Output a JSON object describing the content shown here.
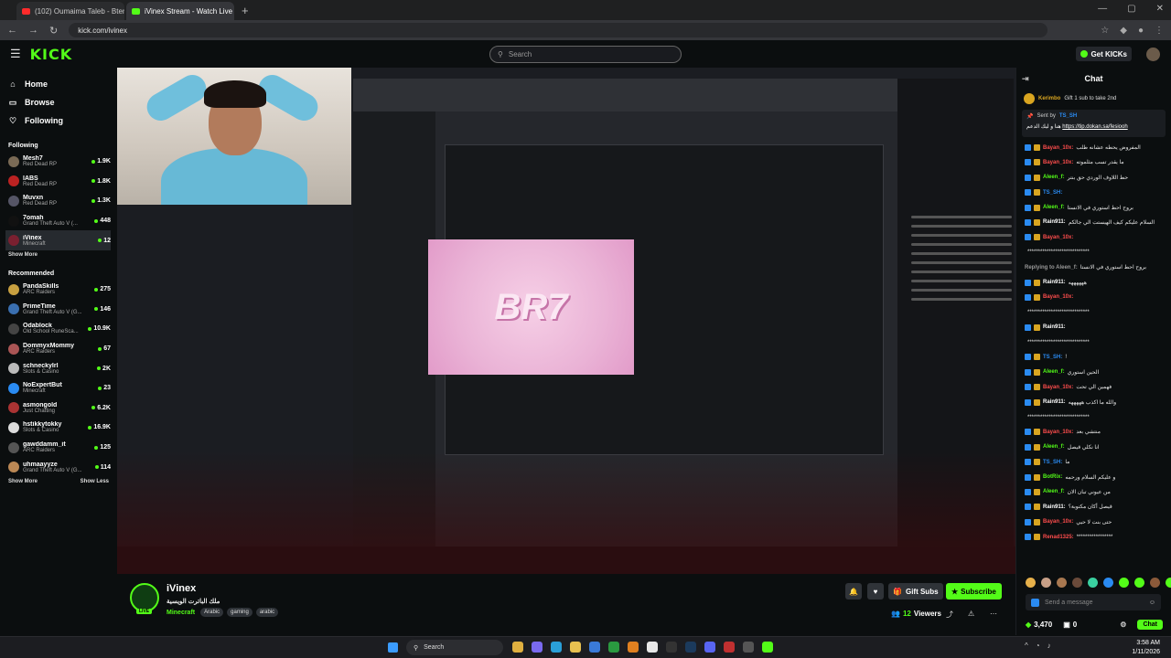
{
  "browser": {
    "tabs": [
      {
        "title": "(102) Oumaima Taleb - Bterjo",
        "color": "#ff2b2b",
        "active": false
      },
      {
        "title": "iVinex Stream - Watch Live on",
        "color": "#53fc18",
        "active": true
      }
    ],
    "url": "kick.com/ivinex"
  },
  "header": {
    "logo": "KICK",
    "search_placeholder": "Search",
    "get_kicks": "Get KICKs"
  },
  "sidebar": {
    "nav": [
      {
        "label": "Home",
        "icon": "home-icon",
        "glyph": "⌂"
      },
      {
        "label": "Browse",
        "icon": "browse-icon",
        "glyph": "▭"
      },
      {
        "label": "Following",
        "icon": "heart-icon",
        "glyph": "♡"
      }
    ],
    "following_title": "Following",
    "following": [
      {
        "name": "Mesh7",
        "category": "Red Dead RP",
        "viewers": "1.9K",
        "color": "#7a6a55"
      },
      {
        "name": "IABS",
        "category": "Red Dead RP",
        "viewers": "1.8K",
        "color": "#b22"
      },
      {
        "name": "Muvxn",
        "category": "Red Dead RP",
        "viewers": "1.3K",
        "color": "#556"
      },
      {
        "name": "7omah",
        "category": "Grand Theft Auto V (...",
        "viewers": "448",
        "color": "#111"
      },
      {
        "name": "iVinex",
        "category": "Minecraft",
        "viewers": "12",
        "color": "#7a2030"
      }
    ],
    "show_more": "Show More",
    "recommended_title": "Recommended",
    "recommended": [
      {
        "name": "PandaSkills",
        "category": "ARC Raiders",
        "viewers": "275",
        "color": "#c8a040"
      },
      {
        "name": "PrimeTime",
        "category": "Grand Theft Auto V (G...",
        "viewers": "146",
        "color": "#3a6fb0"
      },
      {
        "name": "Odablock",
        "category": "Old School RuneSca...",
        "viewers": "10.9K",
        "color": "#444"
      },
      {
        "name": "DommyxMommy",
        "category": "ARC Raiders",
        "viewers": "67",
        "color": "#a55"
      },
      {
        "name": "schneckyIrl",
        "category": "Slots & Casino",
        "viewers": "2K",
        "color": "#bbb"
      },
      {
        "name": "NoExpertBut",
        "category": "Minecraft",
        "viewers": "23",
        "color": "#2a8bf2"
      },
      {
        "name": "asmongold",
        "category": "Just Chatting",
        "viewers": "6.2K",
        "color": "#a33"
      },
      {
        "name": "hstikkytokky",
        "category": "Slots & Casino",
        "viewers": "16.9K",
        "color": "#ddd"
      },
      {
        "name": "gawddamm_it",
        "category": "ARC Raiders",
        "viewers": "125",
        "color": "#555"
      },
      {
        "name": "uhmaayyze",
        "category": "Grand Theft Auto V (G...",
        "viewers": "114",
        "color": "#b85"
      }
    ],
    "show_more_2": "Show More",
    "show_less": "Show Less"
  },
  "stream": {
    "streamer": "iVinex",
    "title": "ملك الباترت الويسية",
    "category": "Minecraft",
    "tags": [
      "Arabic",
      "gaming",
      "arabic"
    ],
    "live_label": "LIVE",
    "gift_subs": "Gift Subs",
    "subscribe": "Subscribe",
    "viewers": "12",
    "viewers_label": "Viewers",
    "video_text": "BR7"
  },
  "chat": {
    "title": "Chat",
    "gifter_name": "Kerimbo",
    "gifter_text": "Gift 1 sub to take 2nd",
    "pinned_sent_by": "Sent by",
    "pinned_user": "TS_SH",
    "pinned_text": "هنا و ليك الدعم",
    "pinned_link": "https://tip.dokan.sa/fesiooh",
    "messages": [
      {
        "user": "Bayan_10x:",
        "color": "#ff4d4d",
        "text": "المفروض يحطه عشانه طلب"
      },
      {
        "user": "Bayan_10x:",
        "color": "#ff4d4d",
        "text": "ما يقدر تسب مثلموته"
      },
      {
        "user": "Aleen_f:",
        "color": "#53fc18",
        "text": "حط اللاوف الوردي حق بنتر"
      },
      {
        "user": "TS_SH:",
        "color": "#2a8bf2",
        "text": ""
      },
      {
        "user": "Aleen_f:",
        "color": "#53fc18",
        "text": "بروح احط استوري في الانستا"
      },
      {
        "user": "Rain911:",
        "color": "#ffffff",
        "text": "السلام عليكم كيف الهيستت الي جالكم"
      },
      {
        "user": "Bayan_10x:",
        "color": "#ff4d4d",
        "text": ""
      },
      {
        "user": "",
        "color": "#ffffff",
        "text": "*****************************"
      },
      {
        "user": "Replying to Aleen_f:",
        "color": "#999999",
        "text": "بروح احط استوري في الانستا"
      },
      {
        "user": "Rain911:",
        "color": "#ffffff",
        "text": "ههههههه"
      },
      {
        "user": "Bayan_10x:",
        "color": "#ff4d4d",
        "text": ""
      },
      {
        "user": "",
        "color": "#ffffff",
        "text": "*****************************"
      },
      {
        "user": "Rain911:",
        "color": "#ffffff",
        "text": ""
      },
      {
        "user": "",
        "color": "#ffffff",
        "text": "*****************************"
      },
      {
        "user": "TS_SH:",
        "color": "#2a8bf2",
        "text": "!"
      },
      {
        "user": "Aleen_f:",
        "color": "#53fc18",
        "text": "الحين استوري"
      },
      {
        "user": "Bayan_10x:",
        "color": "#ff4d4d",
        "text": "فهمين الي تحت"
      },
      {
        "user": "Rain911:",
        "color": "#ffffff",
        "text": "والله ما اكذب هههههه"
      },
      {
        "user": "",
        "color": "#ffffff",
        "text": "*****************************"
      },
      {
        "user": "Bayan_10x:",
        "color": "#ff4d4d",
        "text": "منتشي بعد"
      },
      {
        "user": "Aleen_f:",
        "color": "#53fc18",
        "text": "انا نكلي قيصل"
      },
      {
        "user": "TS_SH:",
        "color": "#2a8bf2",
        "text": "ما"
      },
      {
        "user": "BotRix:",
        "color": "#53fc18",
        "text": "و عليكم السلام ورحمه"
      },
      {
        "user": "Aleen_f:",
        "color": "#53fc18",
        "text": "من عيوني تبان الان"
      },
      {
        "user": "Rain911:",
        "color": "#ffffff",
        "text": "قيصل أكان مكتوبة؟"
      },
      {
        "user": "Bayan_10x:",
        "color": "#ff4d4d",
        "text": "حتى بنت لا حيي"
      },
      {
        "user": "Renad1325:",
        "color": "#ff4d4d",
        "text": "*****************"
      }
    ],
    "input_placeholder": "Send a message",
    "points": "3,470",
    "gifts": "0",
    "chat_button": "Chat"
  },
  "taskbar": {
    "search": "Search",
    "time": "3:58 AM",
    "date": "1/11/2026"
  }
}
